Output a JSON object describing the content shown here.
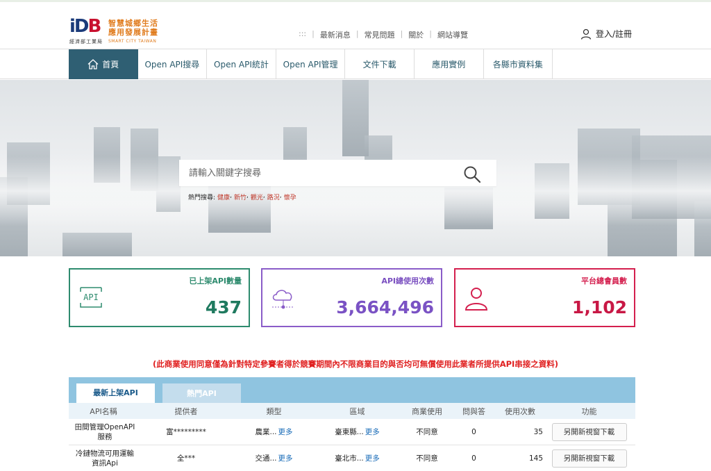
{
  "logo": {
    "mark": "IDB",
    "sub": "經濟部工業局",
    "line1": "智慧城鄉生活",
    "line2": "應用發展計畫",
    "line3": "SMART CITY TAIWAN"
  },
  "toplinks": {
    "dots": ":::",
    "items": [
      "最新消息",
      "常見問題",
      "關於",
      "網站導覽"
    ]
  },
  "login": {
    "label": "登入/註冊"
  },
  "nav": {
    "items": [
      "首頁",
      "Open API搜尋",
      "Open API統計",
      "Open API管理",
      "文件下載",
      "應用實例",
      "各縣市資料集"
    ]
  },
  "search": {
    "placeholder": "請輸入關鍵字搜尋",
    "hot_label": "熱門搜尋:",
    "hot_tags": [
      "健康",
      "新竹",
      "觀光",
      "路況",
      "懷孕"
    ]
  },
  "stats": [
    {
      "label": "已上架API數量",
      "value": "437",
      "icon": "api-icon",
      "color": "#2e8b6e"
    },
    {
      "label": "API總使用次數",
      "value": "3,664,496",
      "icon": "cloud-icon",
      "color": "#8a5cc8"
    },
    {
      "label": "平台總會員數",
      "value": "1,102",
      "icon": "user-icon",
      "color": "#d41f4e"
    }
  ],
  "notice": "(此商業使用同意僅為針對特定參賽者得於競賽期間內不限商業目的與否均可無償使用此業者所提供API串接之資料)",
  "table": {
    "tabs": [
      "最新上架API",
      "熱門API"
    ],
    "headers": [
      "API名稱",
      "提供者",
      "類型",
      "區域",
      "商業使用",
      "問與答",
      "使用次數",
      "功能"
    ],
    "more_label": "更多",
    "rows": [
      {
        "name": "田間管理OpenAPI服務",
        "provider": "富*********",
        "type": "農業...",
        "region": "臺東縣...",
        "commercial": "不同意",
        "qa": "0",
        "count": "35",
        "action": "另開新視窗下載"
      },
      {
        "name": "冷鏈物流可用運輸資訊Api",
        "provider": "全***",
        "type": "交通...",
        "region": "臺北市...",
        "commercial": "不同意",
        "qa": "0",
        "count": "145",
        "action": "另開新視窗下載"
      }
    ]
  }
}
